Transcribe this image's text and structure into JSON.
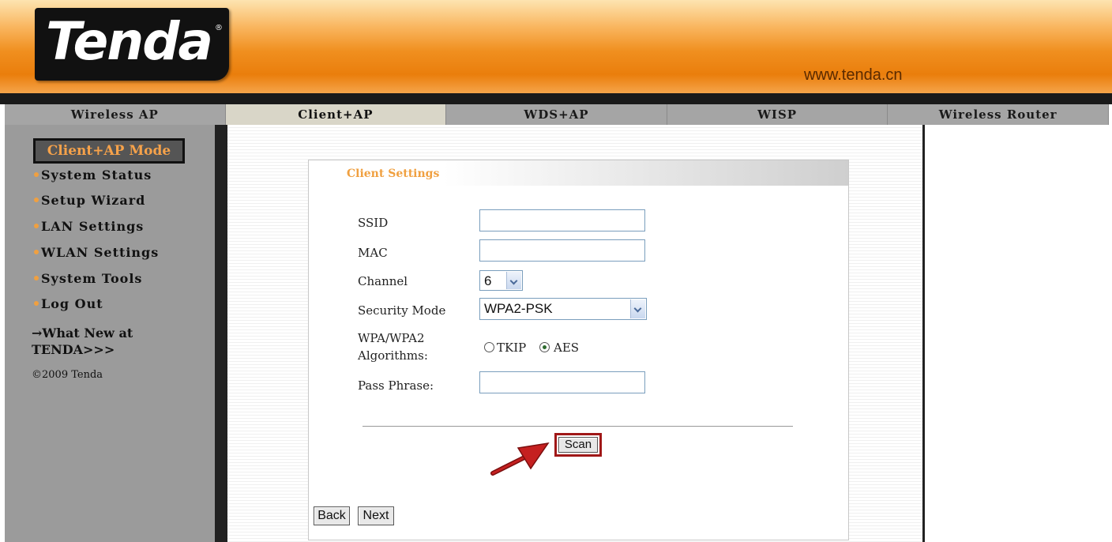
{
  "header": {
    "logo_text": "Tenda",
    "logo_mark": "®",
    "site_url": "www.tenda.cn"
  },
  "tabs": [
    {
      "label": "Wireless AP",
      "active": false
    },
    {
      "label": "Client+AP",
      "active": true
    },
    {
      "label": "WDS+AP",
      "active": false
    },
    {
      "label": "WISP",
      "active": false
    },
    {
      "label": "Wireless Router",
      "active": false
    }
  ],
  "sidebar": {
    "mode_title": "Client+AP Mode",
    "items": [
      {
        "label": "System Status"
      },
      {
        "label": "Setup Wizard"
      },
      {
        "label": "LAN Settings"
      },
      {
        "label": "WLAN Settings"
      },
      {
        "label": "System Tools"
      },
      {
        "label": "Log Out"
      }
    ],
    "whatnew_line1": "→What New at",
    "whatnew_line2": "TENDA>>>",
    "copyright": "©2009 Tenda"
  },
  "panel": {
    "title": "Client Settings",
    "fields": {
      "ssid_label": "SSID",
      "ssid_value": "",
      "mac_label": "MAC",
      "mac_value": "",
      "channel_label": "Channel",
      "channel_value": "6",
      "security_label": "Security Mode",
      "security_value": "WPA2-PSK",
      "algorithms_label_line1": "WPA/WPA2",
      "algorithms_label_line2": "Algorithms:",
      "algorithm_options": [
        {
          "label": "TKIP",
          "selected": false
        },
        {
          "label": "AES",
          "selected": true
        }
      ],
      "passphrase_label": "Pass Phrase:",
      "passphrase_value": ""
    },
    "scan_label": "Scan",
    "back_label": "Back",
    "next_label": "Next"
  },
  "colors": {
    "accent_orange": "#f0a040",
    "highlight_red": "#a01818"
  }
}
